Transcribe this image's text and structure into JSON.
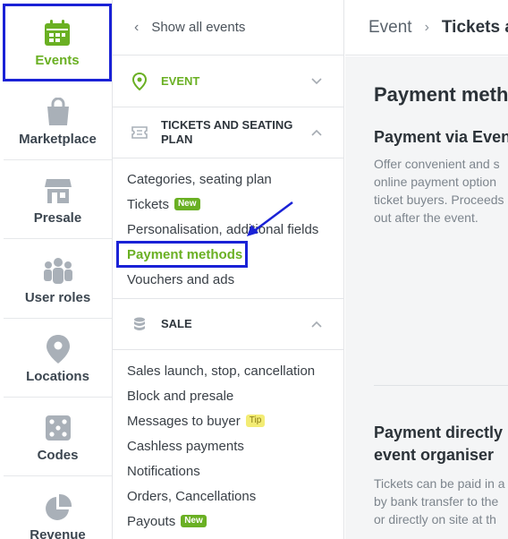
{
  "rail": {
    "items": [
      {
        "label": "Events",
        "icon": "calendar-icon"
      },
      {
        "label": "Marketplace",
        "icon": "shopping-bag-icon"
      },
      {
        "label": "Presale",
        "icon": "store-icon"
      },
      {
        "label": "User roles",
        "icon": "users-icon"
      },
      {
        "label": "Locations",
        "icon": "map-pin-icon"
      },
      {
        "label": "Codes",
        "icon": "dice-icon"
      },
      {
        "label": "Revenue",
        "icon": "pie-chart-icon"
      }
    ]
  },
  "menu": {
    "back_label": "Show all events",
    "sections": [
      {
        "title": "EVENT",
        "icon": "location-icon"
      },
      {
        "title": "TICKETS AND SEATING PLAN",
        "icon": "ticket-icon",
        "items": [
          "Categories, seating plan",
          "Tickets",
          "Personalisation, additional fields",
          "Payment methods",
          "Vouchers and ads"
        ]
      },
      {
        "title": "SALE",
        "icon": "coins-icon",
        "items": [
          "Sales launch, stop, cancellation",
          "Block and presale",
          "Messages to buyer",
          "Cashless payments",
          "Notifications",
          "Orders, Cancellations",
          "Payouts"
        ]
      }
    ],
    "badges": {
      "new": "New",
      "tip": "Tip"
    }
  },
  "content": {
    "breadcrumb": [
      "Event",
      "Tickets a"
    ],
    "title": "Payment meth",
    "block1": {
      "heading": "Payment via Even",
      "lines": [
        "Offer convenient and s",
        "online payment option",
        "ticket buyers. Proceeds",
        "out after the event."
      ]
    },
    "block2": {
      "heading_lines": [
        "Payment directly",
        "event organiser"
      ],
      "lines": [
        "Tickets can be paid in a",
        "by bank transfer to the",
        "or directly on site at th"
      ]
    }
  },
  "colors": {
    "accent": "#6ab023",
    "highlight": "#1a22d6",
    "icon": "#a9b0b8"
  }
}
